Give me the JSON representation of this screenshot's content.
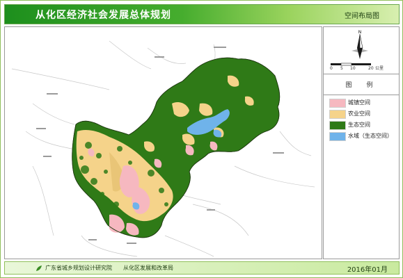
{
  "header": {
    "title": "从化区经济社会发展总体规划",
    "subtitle": "空间布局图"
  },
  "compass": {
    "north_label": "N",
    "scale_ticks": [
      "0",
      "5",
      "10",
      "20"
    ],
    "scale_unit": "公里"
  },
  "legend": {
    "title": "图　例",
    "items": [
      {
        "label": "城镇空间",
        "color": "#f6b8c0"
      },
      {
        "label": "农业空间",
        "color": "#f5d38a"
      },
      {
        "label": "生态空间",
        "color": "#2f7a17"
      },
      {
        "label": "水域（生态空间）",
        "color": "#6fb3ea"
      }
    ]
  },
  "footer": {
    "org1": "广东省城乡规划设计研究院",
    "org2": "从化区发展和改革局",
    "date": "2016年01月"
  },
  "colors": {
    "forest": "#2f7a17",
    "farmland": "#f5d38a",
    "urban": "#f6b8c0",
    "water": "#6fb3ea",
    "header_green": "#1d8f1d"
  }
}
